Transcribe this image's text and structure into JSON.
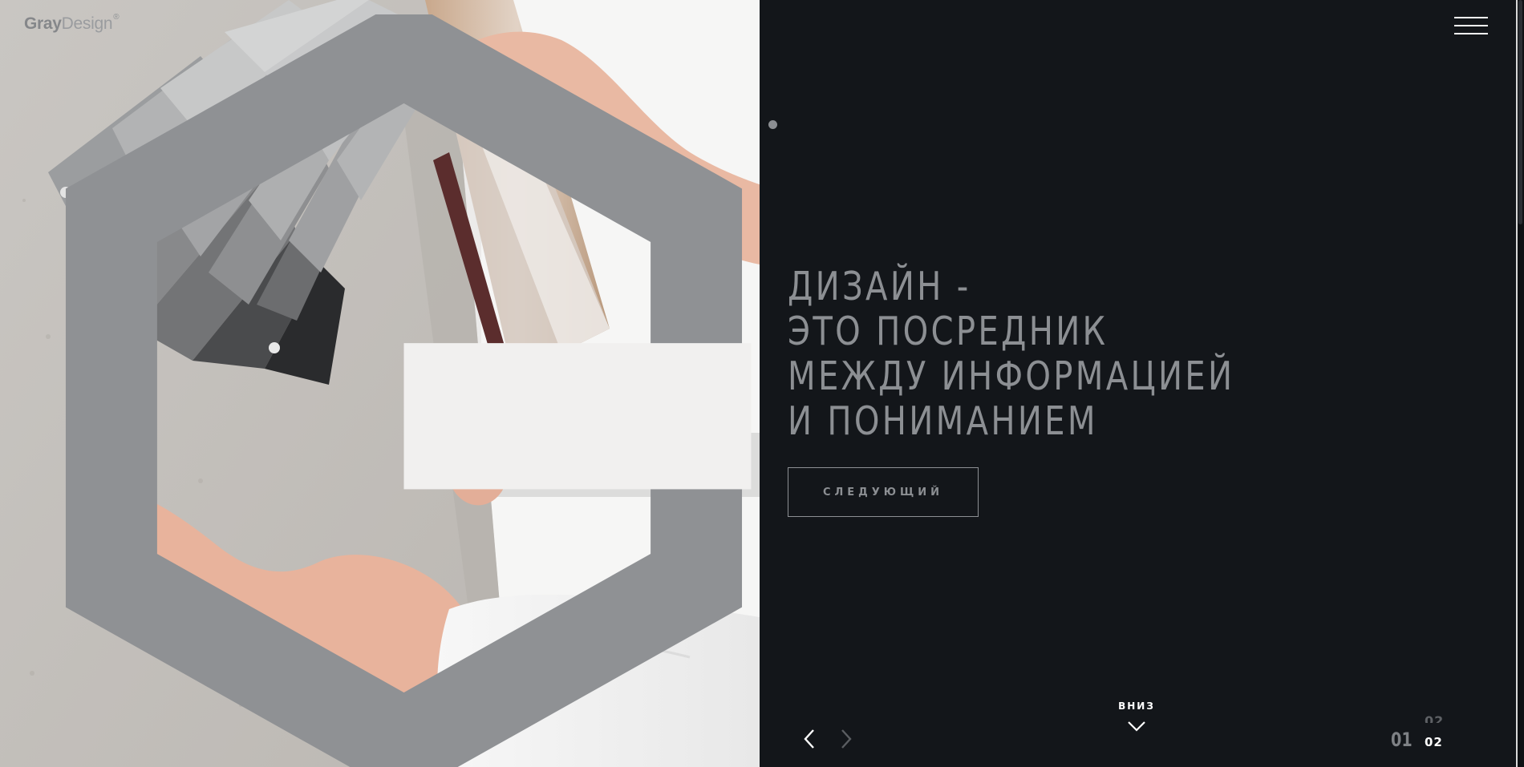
{
  "brand": {
    "logo_bold": "Gray",
    "logo_light": "Design",
    "logo_mark": "®"
  },
  "header": {
    "menu_icon": "hamburger-menu-icon"
  },
  "hero": {
    "headline_lines": [
      "ДИЗАЙН -",
      "ЭТО ПОСРЕДНИК",
      "МЕЖДУ ИНФОРМАЦИЕЙ",
      "И ПОНИМАНИЕМ"
    ],
    "button_label": "СЛЕДУЮЩИЙ"
  },
  "slider": {
    "prev_icon": "chevron-left-icon",
    "next_icon": "chevron-right-icon",
    "current": "01",
    "total": "02",
    "ghost": "02"
  },
  "scroll": {
    "label": "ВНИЗ",
    "icon": "chevron-down-icon"
  },
  "colors": {
    "panel_bg": "#13161a",
    "headline": "#8c8f93",
    "accent_white": "#ffffff"
  }
}
